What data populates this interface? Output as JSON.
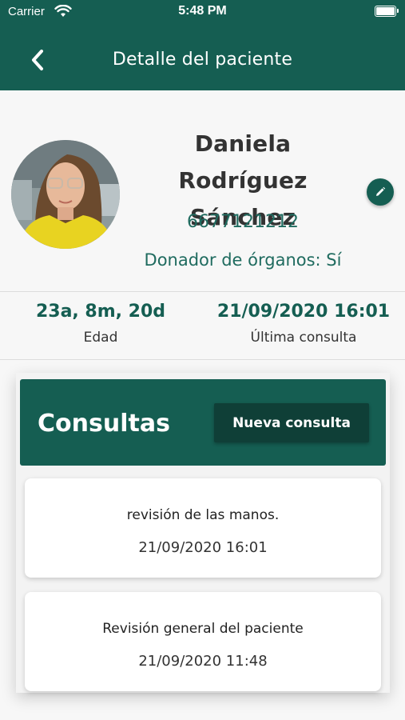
{
  "status_bar": {
    "carrier": "Carrier",
    "time": "5:48 PM"
  },
  "header": {
    "title": "Detalle del paciente",
    "back_icon": "chevron-left-icon"
  },
  "patient": {
    "name_line1": "Daniela Rodríguez",
    "name_line2": "Sánchez",
    "phone": "6677121212",
    "donor": "Donador de órganos: Sí",
    "edit_icon": "pencil-icon"
  },
  "stats": {
    "age_value": "23a, 8m, 20d",
    "age_label": "Edad",
    "last_value": "21/09/2020 16:01",
    "last_label": "Última consulta"
  },
  "consultas": {
    "title": "Consultas",
    "new_button": "Nueva consulta",
    "items": [
      {
        "title": "revisión de las manos.",
        "date": "21/09/2020 16:01"
      },
      {
        "title": "Revisión general del paciente",
        "date": "21/09/2020 11:48"
      }
    ]
  },
  "colors": {
    "primary": "#155e52",
    "button_dark": "#0f3f37",
    "accent_text": "#1f6b5f"
  }
}
